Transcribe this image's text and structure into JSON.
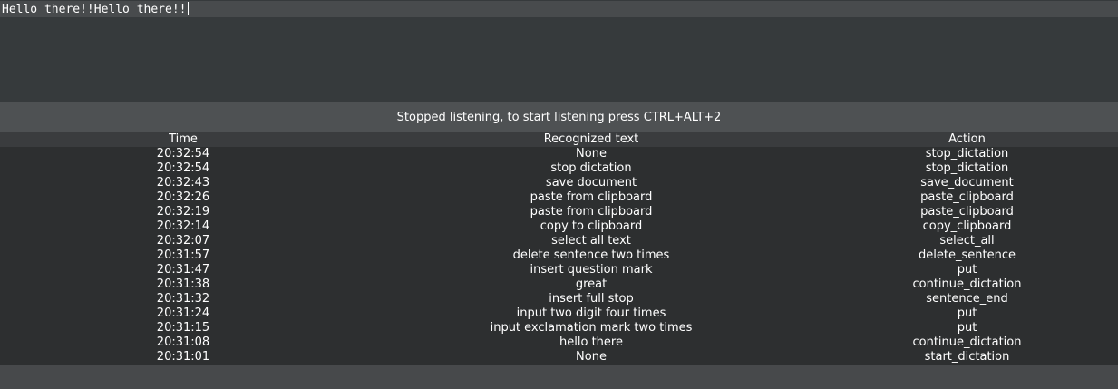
{
  "editor": {
    "text": "Hello there!!Hello there!!"
  },
  "status": {
    "message": "Stopped listening, to start listening press CTRL+ALT+2"
  },
  "table": {
    "headers": {
      "time": "Time",
      "text": "Recognized text",
      "action": "Action"
    },
    "rows": [
      {
        "time": "20:32:54",
        "text": "None",
        "action": "stop_dictation"
      },
      {
        "time": "20:32:54",
        "text": "stop dictation",
        "action": "stop_dictation"
      },
      {
        "time": "20:32:43",
        "text": "save document",
        "action": "save_document"
      },
      {
        "time": "20:32:26",
        "text": "paste from clipboard",
        "action": "paste_clipboard"
      },
      {
        "time": "20:32:19",
        "text": "paste from clipboard",
        "action": "paste_clipboard"
      },
      {
        "time": "20:32:14",
        "text": "copy to clipboard",
        "action": "copy_clipboard"
      },
      {
        "time": "20:32:07",
        "text": "select all text",
        "action": "select_all"
      },
      {
        "time": "20:31:57",
        "text": "delete sentence two times",
        "action": "delete_sentence"
      },
      {
        "time": "20:31:47",
        "text": "insert question mark",
        "action": "put"
      },
      {
        "time": "20:31:38",
        "text": "great",
        "action": "continue_dictation"
      },
      {
        "time": "20:31:32",
        "text": "insert full stop",
        "action": "sentence_end"
      },
      {
        "time": "20:31:24",
        "text": "input two digit four times",
        "action": "put"
      },
      {
        "time": "20:31:15",
        "text": "input exclamation mark two times",
        "action": "put"
      },
      {
        "time": "20:31:08",
        "text": "hello there",
        "action": "continue_dictation"
      },
      {
        "time": "20:31:01",
        "text": "None",
        "action": "start_dictation"
      }
    ]
  },
  "colors": {
    "background": "#3c3f41",
    "editor_bg": "#363a3c",
    "editor_line": "#484b4d",
    "status_bg": "#4e5153",
    "table_bg": "#2d2f30",
    "text": "#ffffff"
  }
}
